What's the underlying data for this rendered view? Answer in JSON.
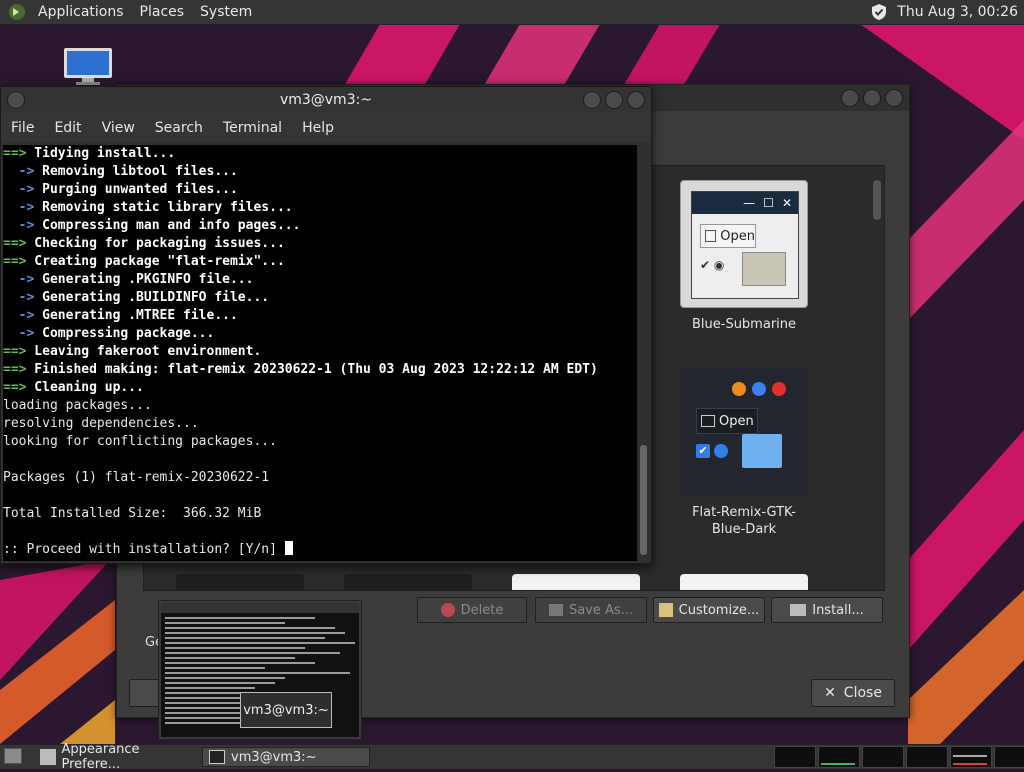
{
  "top_panel": {
    "menus": [
      "Applications",
      "Places",
      "System"
    ],
    "clock": "Thu Aug  3, 00:26"
  },
  "terminal": {
    "title": "vm3@vm3:~",
    "menu": [
      "File",
      "Edit",
      "View",
      "Search",
      "Terminal",
      "Help"
    ],
    "lines": [
      {
        "prefix": "==>",
        "kind": "main",
        "text": " Tidying install..."
      },
      {
        "prefix": "  ->",
        "kind": "sub",
        "text": " Removing libtool files..."
      },
      {
        "prefix": "  ->",
        "kind": "sub",
        "text": " Purging unwanted files..."
      },
      {
        "prefix": "  ->",
        "kind": "sub",
        "text": " Removing static library files..."
      },
      {
        "prefix": "  ->",
        "kind": "sub",
        "text": " Compressing man and info pages..."
      },
      {
        "prefix": "==>",
        "kind": "main",
        "text": " Checking for packaging issues..."
      },
      {
        "prefix": "==>",
        "kind": "main",
        "text": " Creating package \"flat-remix\"..."
      },
      {
        "prefix": "  ->",
        "kind": "sub",
        "text": " Generating .PKGINFO file..."
      },
      {
        "prefix": "  ->",
        "kind": "sub",
        "text": " Generating .BUILDINFO file..."
      },
      {
        "prefix": "  ->",
        "kind": "sub",
        "text": " Generating .MTREE file..."
      },
      {
        "prefix": "  ->",
        "kind": "sub",
        "text": " Compressing package..."
      },
      {
        "prefix": "==>",
        "kind": "main",
        "text": " Leaving fakeroot environment."
      },
      {
        "prefix": "==>",
        "kind": "main",
        "text": " Finished making: flat-remix 20230622-1 (Thu 03 Aug 2023 12:22:12 AM EDT)"
      },
      {
        "prefix": "==>",
        "kind": "main",
        "text": " Cleaning up..."
      },
      {
        "prefix": "",
        "kind": "plain",
        "text": "loading packages..."
      },
      {
        "prefix": "",
        "kind": "plain",
        "text": "resolving dependencies..."
      },
      {
        "prefix": "",
        "kind": "plain",
        "text": "looking for conflicting packages..."
      },
      {
        "prefix": "",
        "kind": "plain",
        "text": ""
      },
      {
        "prefix": "",
        "kind": "plain",
        "text": "Packages (1) flat-remix-20230622-1"
      },
      {
        "prefix": "",
        "kind": "plain",
        "text": ""
      },
      {
        "prefix": "",
        "kind": "plain",
        "text": "Total Installed Size:  366.32 MiB"
      },
      {
        "prefix": "",
        "kind": "plain",
        "text": ""
      },
      {
        "prefix": "",
        "kind": "prompt",
        "text": ":: Proceed with installation? [Y/n] "
      }
    ]
  },
  "appearance": {
    "themes": [
      {
        "name": "Blue-Submarine",
        "open_label": "Open"
      },
      {
        "name": "Flat-Remix-GTK-Blue-Dark",
        "name_line1": "Flat-Remix-GTK-",
        "name_line2": "Blue-Dark",
        "open_label": "Open"
      }
    ],
    "buttons": {
      "delete": "Delete",
      "save_as": "Save As...",
      "customize": "Customize...",
      "install": "Install...",
      "close": "Close"
    },
    "ge_label": "Ge"
  },
  "preview_tooltip": "vm3@vm3:~",
  "taskbar": {
    "tasks": [
      "Appearance Prefere...",
      "vm3@vm3:~"
    ]
  },
  "colors": {
    "accent_pink": "#e8156e",
    "terminal_arrow_green": "#5fbf4a",
    "terminal_arrow_blue": "#5b8ee6",
    "flat_remix_blue": "#2f7fe6"
  }
}
